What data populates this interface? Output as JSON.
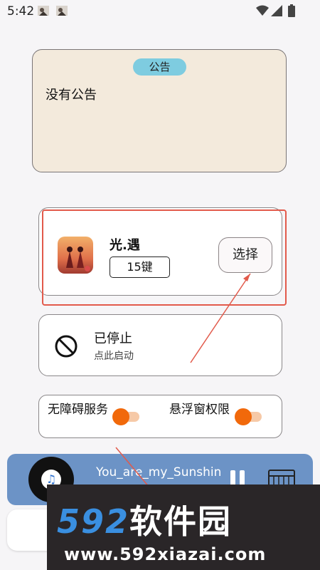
{
  "status_bar": {
    "time": "5:42"
  },
  "notice": {
    "tag": "公告",
    "content": "没有公告"
  },
  "game_card": {
    "title": "光.遇",
    "keys_badge": "15键",
    "select_label": "选择"
  },
  "service_card": {
    "status": "已停止",
    "hint": "点此启动"
  },
  "permissions": {
    "accessibility_label": "无障碍服务",
    "overlay_label": "悬浮窗权限"
  },
  "player": {
    "song_title": "You_are_my_Sunshin"
  },
  "watermark": {
    "logo_digits": "592",
    "logo_text": "软件园",
    "url": "www.592xiazai.com"
  },
  "colors": {
    "accent_orange": "#f1690b",
    "notice_bg": "#f3eadc",
    "tag_bg": "#7ecce0",
    "player_bg": "#6c93c6",
    "highlight_red": "#e25a4b"
  }
}
